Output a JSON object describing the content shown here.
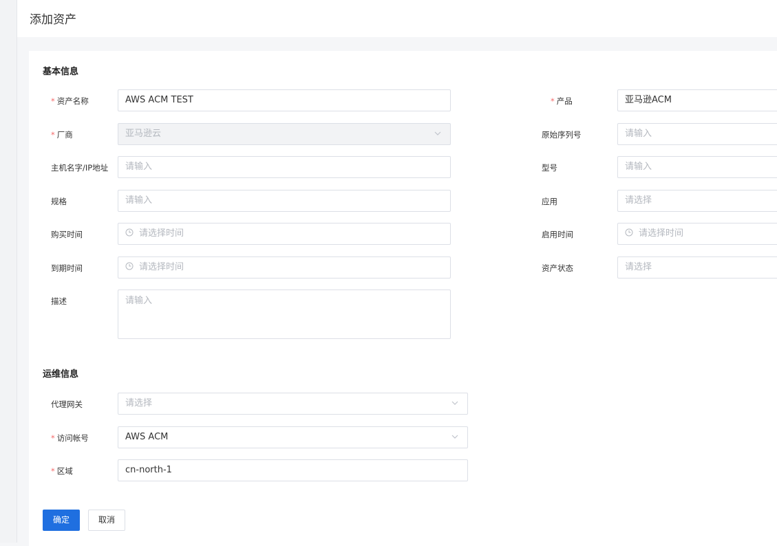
{
  "page": {
    "title": "添加资产"
  },
  "basic": {
    "section_title": "基本信息",
    "asset_name": {
      "label": "资产名称",
      "value": "AWS ACM TEST"
    },
    "product": {
      "label": "产品",
      "value": "亚马逊ACM"
    },
    "vendor": {
      "label": "厂商",
      "value": "亚马逊云"
    },
    "serial": {
      "label": "原始序列号",
      "placeholder": "请输入"
    },
    "hostname": {
      "label": "主机名字/IP地址",
      "placeholder": "请输入"
    },
    "model": {
      "label": "型号",
      "placeholder": "请输入"
    },
    "spec": {
      "label": "规格",
      "placeholder": "请输入"
    },
    "application": {
      "label": "应用",
      "placeholder": "请选择"
    },
    "purchase_time": {
      "label": "购买时间",
      "placeholder": "请选择时间"
    },
    "enable_time": {
      "label": "启用时间",
      "placeholder": "请选择时间"
    },
    "expire_time": {
      "label": "到期时间",
      "placeholder": "请选择时间"
    },
    "asset_status": {
      "label": "资产状态",
      "placeholder": "请选择"
    },
    "description": {
      "label": "描述",
      "placeholder": "请输入"
    }
  },
  "ops": {
    "section_title": "运维信息",
    "proxy_gateway": {
      "label": "代理网关",
      "placeholder": "请选择"
    },
    "access_account": {
      "label": "访问帐号",
      "value": "AWS ACM"
    },
    "region": {
      "label": "区域",
      "value": "cn-north-1"
    }
  },
  "actions": {
    "confirm": "确定",
    "cancel": "取消"
  },
  "colors": {
    "primary": "#1f6fe0",
    "required": "#f56c6c",
    "border": "#dcdfe6"
  }
}
